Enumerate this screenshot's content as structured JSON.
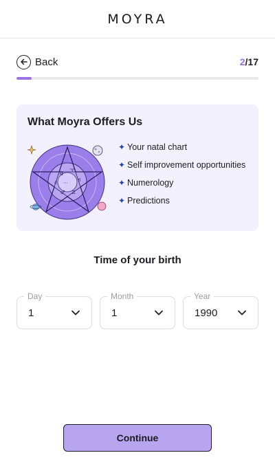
{
  "app": {
    "logo": "MOYRA"
  },
  "nav": {
    "back_label": "Back",
    "step_current": "2",
    "step_total": "/17",
    "progress_fraction": 0.0625
  },
  "offers": {
    "title": "What Moyra Offers Us",
    "items": [
      {
        "label": "Your natal chart"
      },
      {
        "label": "Self improvement opportunities"
      },
      {
        "label": "Numerology"
      },
      {
        "label": "Predictions"
      }
    ],
    "bullet_icon": "plus-star-icon",
    "illustration_icon": "astrology-wheel-icon"
  },
  "form": {
    "title": "Time of your birth",
    "day": {
      "label": "Day",
      "value": "1"
    },
    "month": {
      "label": "Month",
      "value": "1"
    },
    "year": {
      "label": "Year",
      "value": "1990"
    }
  },
  "actions": {
    "continue_label": "Continue"
  },
  "colors": {
    "accent": "#9c72e6",
    "card_bg": "#f3f1fe",
    "button_bg": "#b7a5f0",
    "bullet": "#2146b3"
  }
}
